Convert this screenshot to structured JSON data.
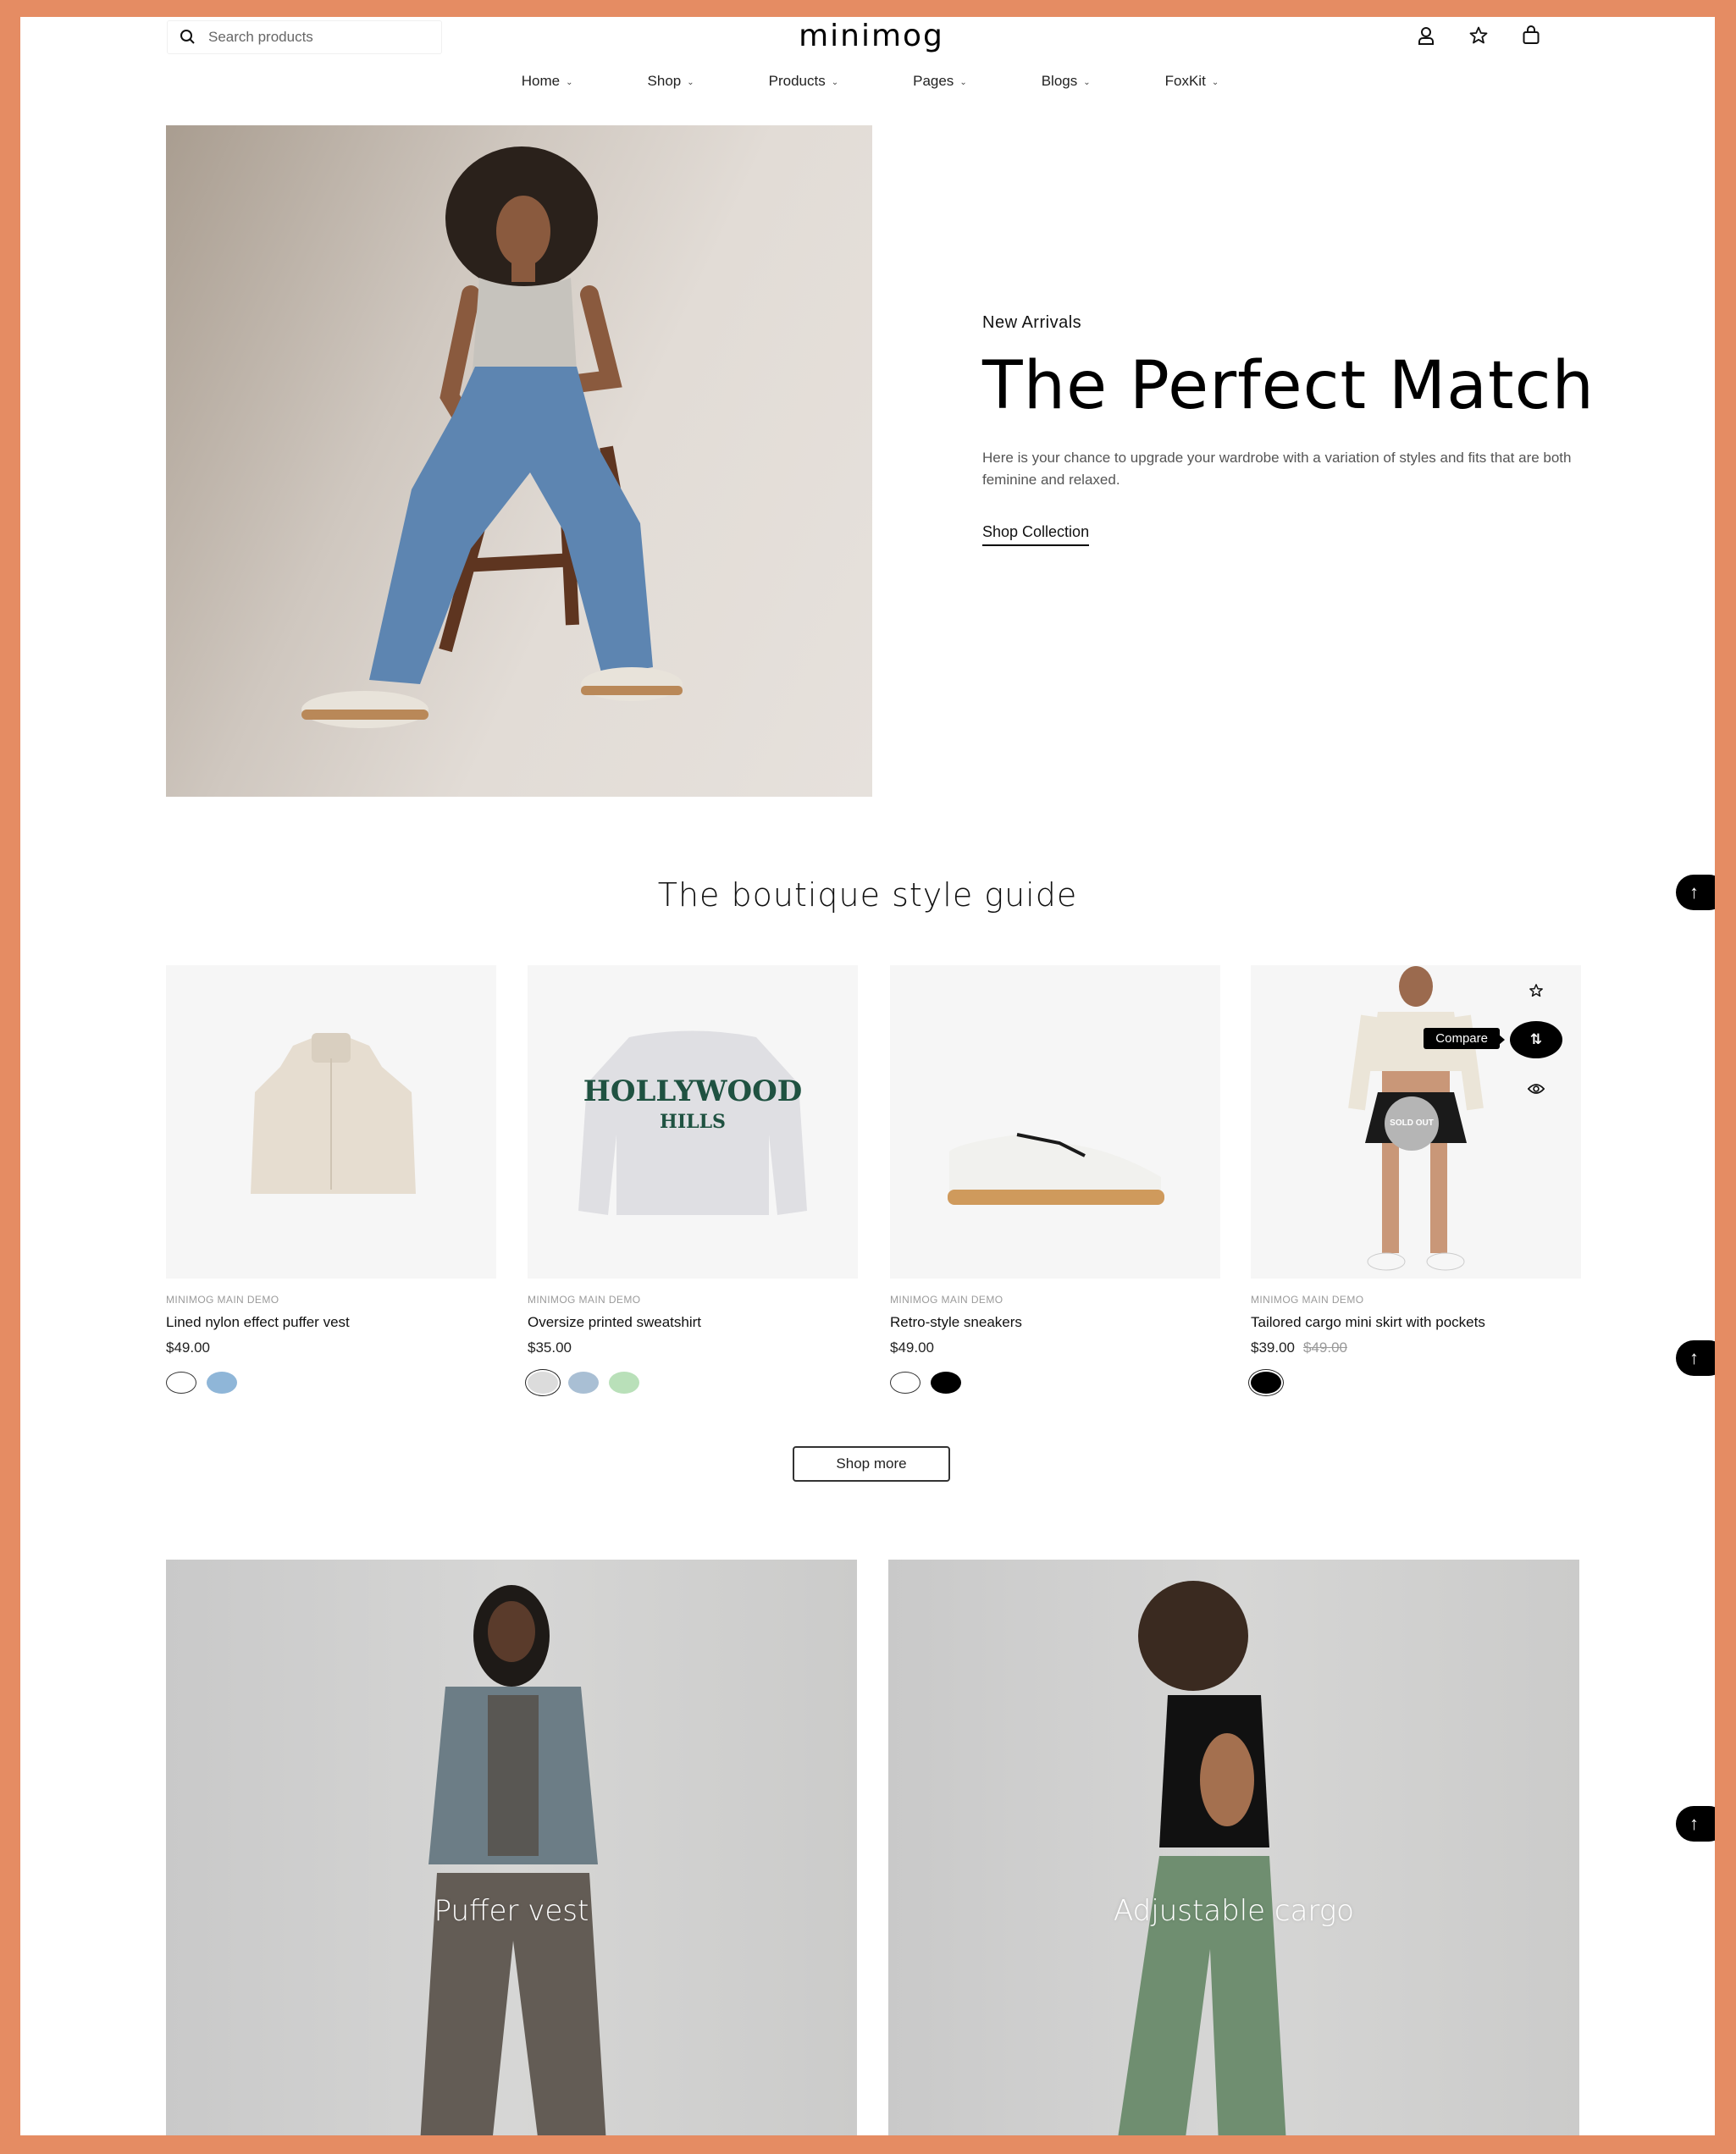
{
  "header": {
    "search_placeholder": "Search products",
    "logo": "minimog",
    "icons": [
      "user-icon",
      "wishlist-star-icon",
      "cart-bag-icon"
    ]
  },
  "nav": [
    {
      "label": "Home"
    },
    {
      "label": "Shop"
    },
    {
      "label": "Products"
    },
    {
      "label": "Pages"
    },
    {
      "label": "Blogs"
    },
    {
      "label": "FoxKit"
    }
  ],
  "hero": {
    "eyebrow": "New Arrivals",
    "title": "The Perfect Match",
    "description": "Here is your chance to upgrade your wardrobe with a variation of styles and fits that are both feminine and relaxed.",
    "cta": "Shop Collection"
  },
  "section": {
    "title": "The boutique style guide",
    "shop_more": "Shop more"
  },
  "products": [
    {
      "vendor": "MINIMOG MAIN DEMO",
      "title": "Lined nylon effect puffer vest",
      "price": "$49.00",
      "compare_price": "",
      "swatches": [
        "#ffffff",
        "#8fb6d8"
      ]
    },
    {
      "vendor": "MINIMOG MAIN DEMO",
      "title": "Oversize printed sweatshirt",
      "price": "$35.00",
      "compare_price": "",
      "swatches": [
        "#dcdcdc",
        "#a9bfd4",
        "#b9e0b9"
      ]
    },
    {
      "vendor": "MINIMOG MAIN DEMO",
      "title": "Retro-style sneakers",
      "price": "$49.00",
      "compare_price": "",
      "swatches": [
        "#ffffff",
        "#000000"
      ]
    },
    {
      "vendor": "MINIMOG MAIN DEMO",
      "title": "Tailored cargo mini skirt with pockets",
      "price": "$39.00",
      "compare_price": "$49.00",
      "swatches": [
        "#000000"
      ],
      "badge": "SOLD OUT",
      "tooltip": "Compare"
    }
  ],
  "collections": [
    {
      "label": "Puffer vest"
    },
    {
      "label": "Adjustable cargo"
    }
  ],
  "colors": {
    "frame": "#e58c63",
    "accent": "#000000"
  }
}
